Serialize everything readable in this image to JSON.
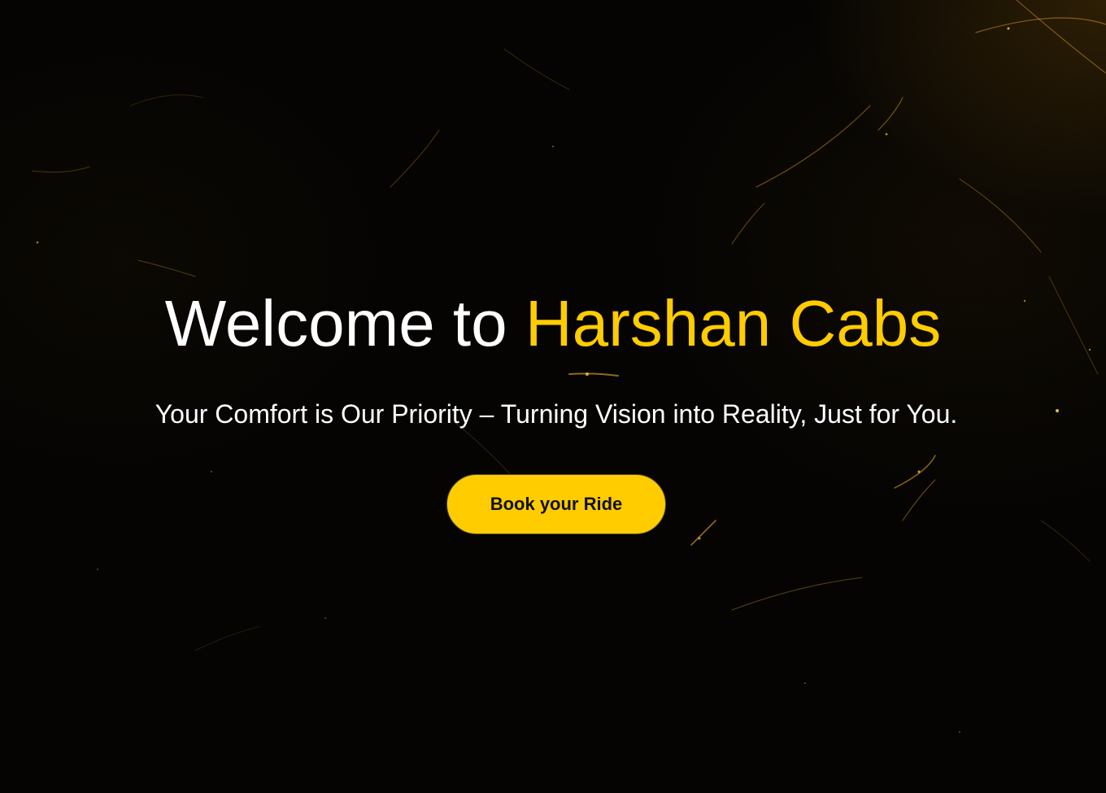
{
  "hero": {
    "title_prefix": "Welcome to ",
    "title_brand": "Harshan Cabs",
    "tagline": "Your Comfort is Our Priority – Turning Vision into Reality, Just for You.",
    "cta_label": "Book your Ride"
  },
  "colors": {
    "accent": "#ffcc00",
    "background": "#050403",
    "text": "#ffffff"
  }
}
